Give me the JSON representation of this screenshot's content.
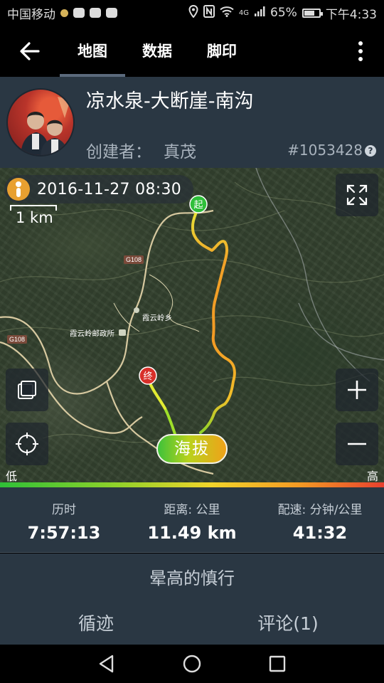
{
  "status_bar": {
    "carrier": "中国移动",
    "network": "4G",
    "battery": "65%",
    "time": "下午4:33",
    "battery_level": 0.65
  },
  "toolbar": {
    "tabs": [
      {
        "label": "地图",
        "active": true
      },
      {
        "label": "数据",
        "active": false
      },
      {
        "label": "脚印",
        "active": false
      }
    ]
  },
  "route": {
    "title": "凉水泉-大断崖-南沟",
    "creator_label": "创建者：",
    "creator_name": "真茂",
    "id": "#1053428",
    "help": "?"
  },
  "map": {
    "date": "2016-11-27 08:30",
    "scale": "1 km",
    "start_marker": "起",
    "end_marker": "终",
    "road_labels": [
      "G108",
      "G108"
    ],
    "place_labels": [
      "霞云岭乡",
      "霞云岭邮政所"
    ],
    "altitude_button": "海拔",
    "legend_low": "低",
    "legend_high": "高"
  },
  "stats": [
    {
      "label": "历时",
      "value": "7:57:13"
    },
    {
      "label": "距离: 公里",
      "value": "11.49 km"
    },
    {
      "label": "配速: 分钟/公里",
      "value": "41:32"
    }
  ],
  "route_subtitle": "晕高的慎行",
  "bottom_tabs": [
    {
      "label": "循迹"
    },
    {
      "label": "评论(1)"
    }
  ],
  "icons": {
    "back": "arrow-left-icon",
    "more": "more-vertical-icon",
    "fullscreen": "expand-icon",
    "layers": "layers-icon",
    "locate": "crosshair-icon",
    "zoom_in": "plus-icon",
    "zoom_out": "minus-icon"
  },
  "colors": {
    "panel": "#2a3743",
    "track_low": "#2ec037",
    "track_high": "#e8402e"
  }
}
